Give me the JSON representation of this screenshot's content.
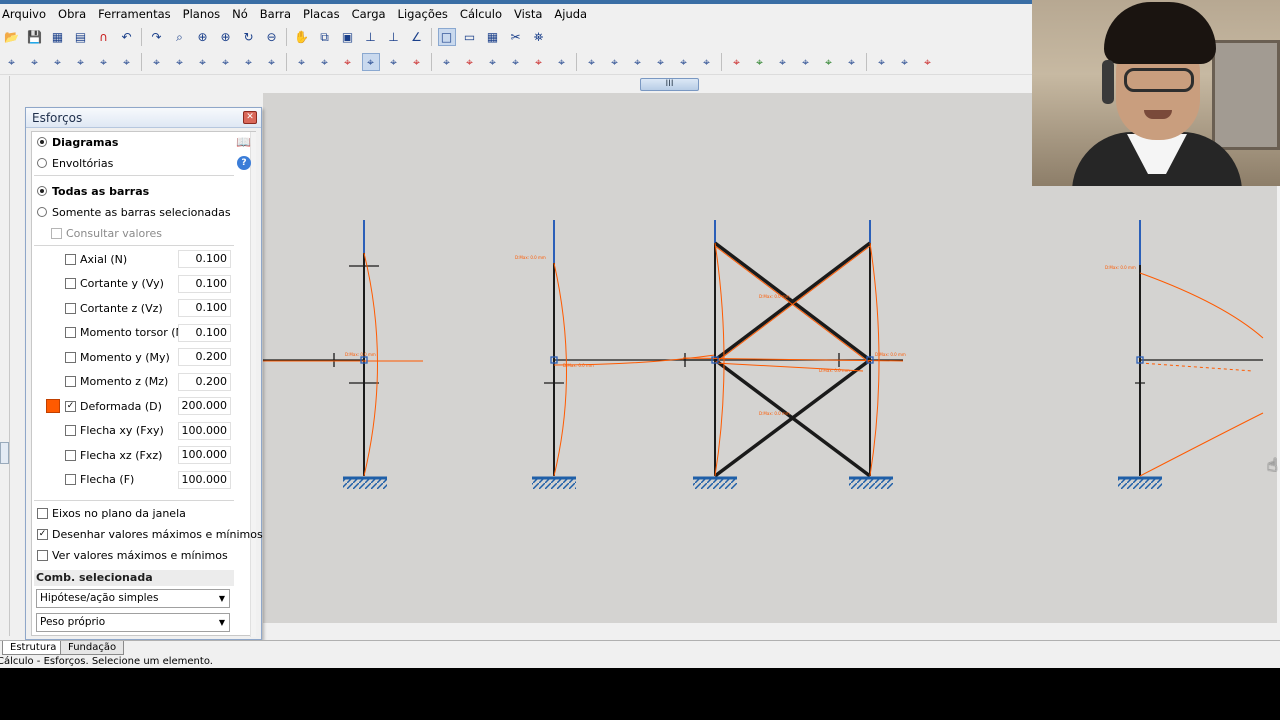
{
  "menu": [
    "Arquivo",
    "Obra",
    "Ferramentas",
    "Planos",
    "Nó",
    "Barra",
    "Placas",
    "Carga",
    "Ligações",
    "Cálculo",
    "Vista",
    "Ajuda"
  ],
  "toolbar1": [
    "open-folder-icon",
    "save-icon",
    "print-preview-icon",
    "print-icon",
    "magnet-icon",
    "undo-icon",
    "redo-icon",
    "zoom-window-icon",
    "zoom-all-icon",
    "zoom-in-icon",
    "regenerate-icon",
    "zoom-out-icon",
    "pan-hand-icon",
    "zoom-previous-icon",
    "node-number-icon",
    "axis-icon",
    "support-icon",
    "angle-icon",
    "rectangle-icon",
    "display-icon",
    "table-icon",
    "scissors-icon",
    "binoculars-icon"
  ],
  "toolbar2": [
    "settings-icon",
    "materials-icon",
    "load-icon",
    "arrow-icon",
    "node-icon",
    "axes-icon",
    "move-icon",
    "select-icon",
    "dim-icon",
    "trim-icon",
    "grid-icon",
    "mesh-icon",
    "frame-icon",
    "section-icon",
    "delete-icon",
    "view-icon",
    "member-icon",
    "member-delete-icon",
    "diagonal-icon",
    "diagonal-delete-icon",
    "hinge-icon",
    "release-icon",
    "brace-icon",
    "angle-member-icon",
    "joint-icon",
    "link-icon",
    "tie-icon",
    "pin-icon",
    "truss-icon",
    "beam-icon",
    "column-icon",
    "green-arrow-icon",
    "cursor-icon",
    "cursor2-icon",
    "results-icon",
    "pen-icon",
    "copy-icon",
    "frame2-icon",
    "frame3-icon"
  ],
  "scrollbar_label": "III",
  "panel": {
    "title": "Esforços",
    "diagramas": "Diagramas",
    "envoltorias": "Envoltórias",
    "todas_barras": "Todas as barras",
    "somente": "Somente as barras selecionadas",
    "consultar": "Consultar valores",
    "items": [
      {
        "label": "Axial (N)",
        "value": "0.100",
        "checked": false
      },
      {
        "label": "Cortante y (Vy)",
        "value": "0.100",
        "checked": false
      },
      {
        "label": "Cortante z (Vz)",
        "value": "0.100",
        "checked": false
      },
      {
        "label": "Momento torsor (Mt)",
        "value": "0.100",
        "checked": false
      },
      {
        "label": "Momento y (My)",
        "value": "0.200",
        "checked": false
      },
      {
        "label": "Momento z (Mz)",
        "value": "0.200",
        "checked": false
      },
      {
        "label": "Deformada (D)",
        "value": "200.000",
        "checked": true
      },
      {
        "label": "Flecha xy (Fxy)",
        "value": "100.000",
        "checked": false
      },
      {
        "label": "Flecha xz (Fxz)",
        "value": "100.000",
        "checked": false
      },
      {
        "label": "Flecha (F)",
        "value": "100.000",
        "checked": false
      }
    ],
    "eixos": "Eixos no plano da janela",
    "desenhar": "Desenhar valores máximos e mínimos",
    "ver": "Ver valores máximos e mínimos",
    "comb_title": "Comb. selecionada",
    "combo1": "Hipótese/ação simples",
    "combo2": "Peso próprio",
    "check_mark": "✓",
    "close_glyph": "✕",
    "help_glyph": "?",
    "book_glyph": "📖",
    "combo_arrow": "▼"
  },
  "tabs": [
    "Estrutura",
    "Fundação"
  ],
  "status": "Cálculo - Esforços.  Selecione um elemento.",
  "colors": {
    "canvas": "#d4d3d1",
    "member": "#1a1a1a",
    "column_top": "#2b5fb8",
    "deformed": "#ff5a00",
    "support": "#1f5fa8",
    "swatch": "#ff5a00"
  },
  "cursor_glyph": "☝"
}
